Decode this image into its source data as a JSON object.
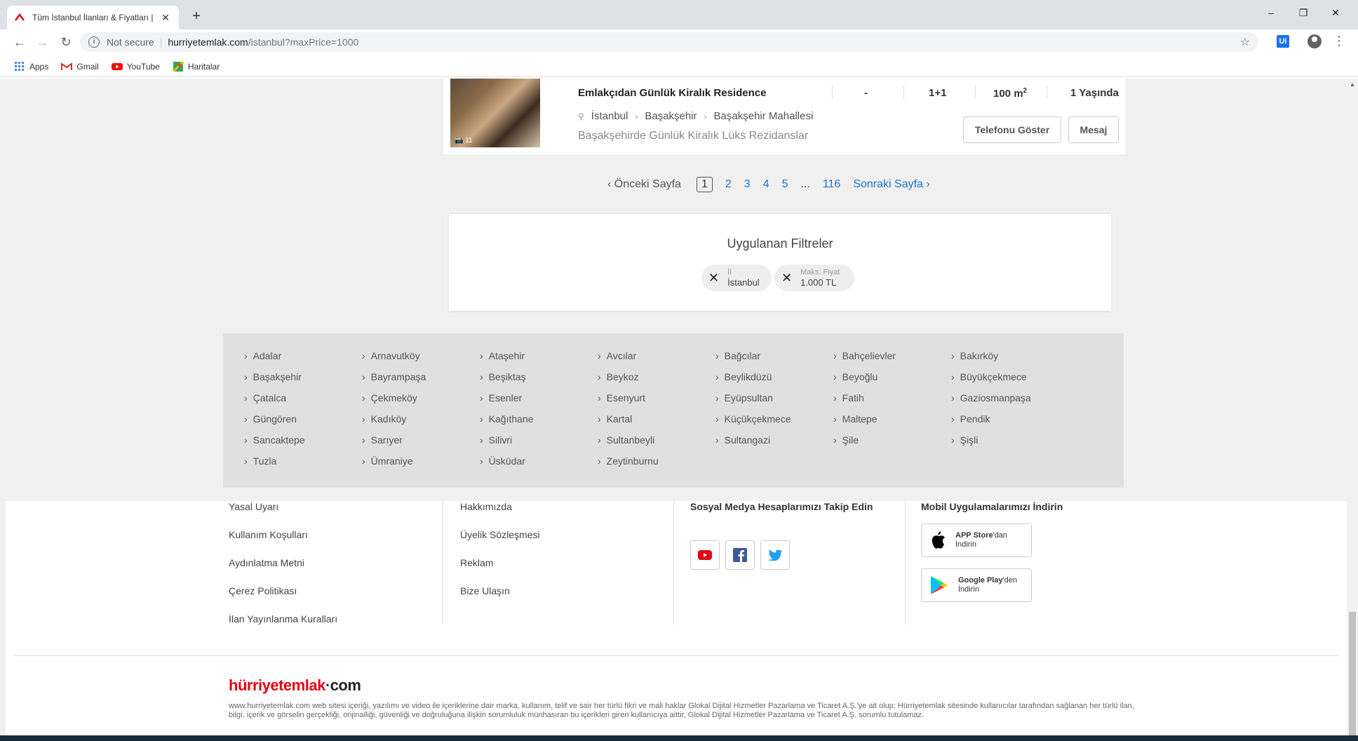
{
  "browser": {
    "tab_title": "Tüm İstanbul İlanları & Fiyatları |",
    "address_secure_label": "Not secure",
    "address_host": "hurriyetemlak.com",
    "address_path": "/istanbul?maxPrice=1000",
    "ext_label": "Ui",
    "bookmarks": [
      {
        "label": "Apps",
        "icon": "apps-grid-icon"
      },
      {
        "label": "Gmail",
        "icon": "gmail-icon"
      },
      {
        "label": "YouTube",
        "icon": "youtube-icon"
      },
      {
        "label": "Haritalar",
        "icon": "maps-icon"
      }
    ]
  },
  "listing": {
    "photo_count": "11",
    "title": "Emlakçıdan Günlük Kiralık Residence",
    "room_dash": "-",
    "rooms": "1+1",
    "area": "100 m",
    "area_sup": "2",
    "age": "1 Yaşında",
    "location": [
      "İstanbul",
      "Başakşehir",
      "Başakşehir Mahallesi"
    ],
    "description": "Başakşehirde Günlük Kiralık Lüks Rezidanslar",
    "phone_button": "Telefonu Göster",
    "message_button": "Mesaj"
  },
  "pagination": {
    "prev": "Önceki Sayfa",
    "pages": [
      "1",
      "2",
      "3",
      "4",
      "5"
    ],
    "ellipsis": "...",
    "last": "116",
    "next": "Sonraki Sayfa"
  },
  "filters": {
    "heading": "Uygulanan Filtreler",
    "chips": [
      {
        "key": "İl",
        "value": "İstanbul"
      },
      {
        "key": "Maks. Fiyat",
        "value": "1.000 TL"
      }
    ]
  },
  "districts": [
    [
      "Adalar",
      "Arnavutköy",
      "Ataşehir",
      "Avcılar",
      "Bağcılar",
      "Bahçelievler",
      "Bakırköy"
    ],
    [
      "Başakşehir",
      "Bayrampaşa",
      "Beşiktaş",
      "Beykoz",
      "Beylikdüzü",
      "Beyoğlu",
      "Büyükçekmece"
    ],
    [
      "Çatalca",
      "Çekmeköy",
      "Esenler",
      "Esenyurt",
      "Eyüpsultan",
      "Fatih",
      "Gaziosmanpaşa"
    ],
    [
      "Güngören",
      "Kadıköy",
      "Kağıthane",
      "Kartal",
      "Küçükçekmece",
      "Maltepe",
      "Pendik"
    ],
    [
      "Sancaktepe",
      "Sarıyer",
      "Silivri",
      "Sultanbeyli",
      "Sultangazi",
      "Şile",
      "Şişli"
    ],
    [
      "Tuzla",
      "Ümraniye",
      "Üsküdar",
      "Zeytinburnu"
    ]
  ],
  "footer": {
    "col1": [
      "Yasal Uyarı",
      "Kullanım Koşulları",
      "Aydınlatma Metni",
      "Çerez Politikası",
      "İlan Yayınlanma Kuralları"
    ],
    "col2": [
      "Hakkımızda",
      "Üyelik Sözleşmesi",
      "Reklam",
      "Bize Ulaşın"
    ],
    "social_heading": "Sosyal Medya Hesaplarımızı Takip Edin",
    "app_heading": "Mobil Uygulamalarımızı İndirin",
    "app_store_bold": "APP Store",
    "app_store_rest": "'dan",
    "app_store_line2": "İndirin",
    "google_play_bold": "Google Play",
    "google_play_rest": "'den",
    "google_play_line2": "İndirin",
    "logo_part1": "hürriyet",
    "logo_part2": "emlak",
    "logo_part3": "·com",
    "legal": "www.hurriyetemlak.com web sitesi içeriği, yazılımı ve video ile içeriklerine dair marka, kullanım, telif ve sair her türlü fikri ve mali haklar Glokal Dijital Hizmetler Pazarlama ve Ticaret A.Ş.'ye ait olup; Hürriyetemlak sitesinde kullanıcılar tarafından sağlanan her türlü ilan, bilgi, içerik ve görselin gerçekliği, orijinalliği, güvenliği ve doğruluğuna ilişkin sorumluluk münhasıran bu içerikleri giren kullanıcıya aittir, Glokal Dijital Hizmetler Pazarlama ve Ticaret A.Ş. sorumlu tutulamaz."
  },
  "colors": {
    "brand_red": "#e30613",
    "link_blue": "#1a73c8"
  }
}
